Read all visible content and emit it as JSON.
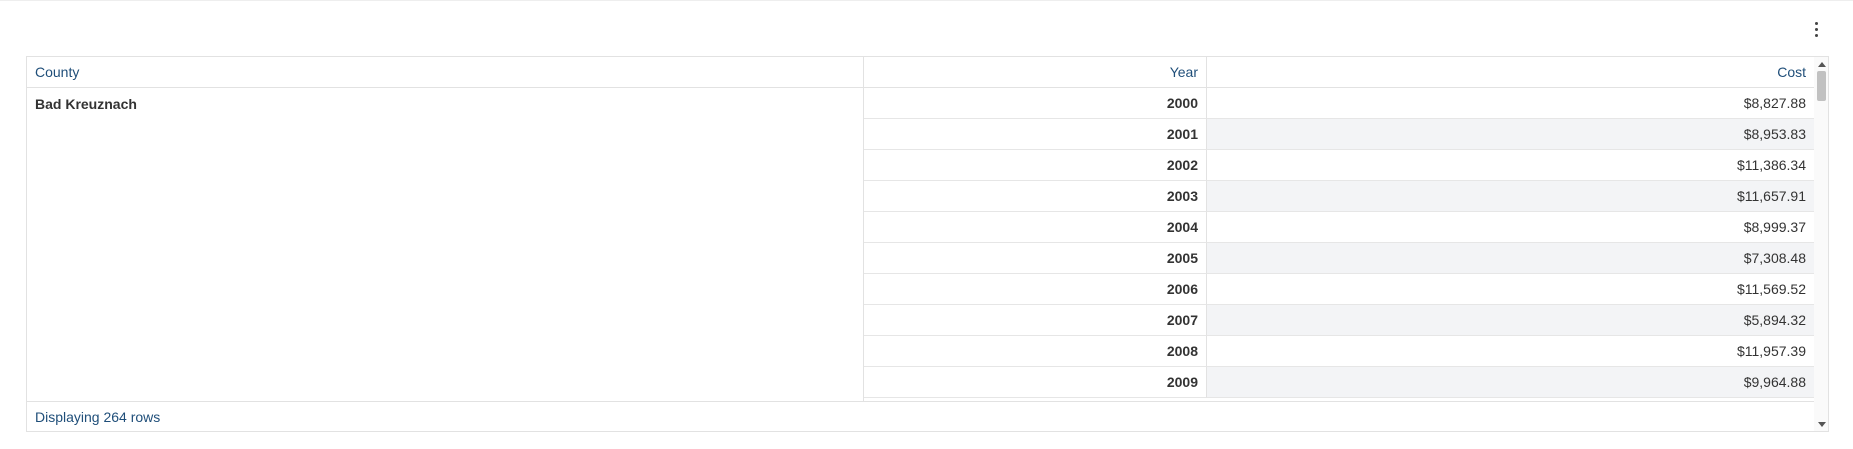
{
  "table": {
    "columns": {
      "county": "County",
      "year": "Year",
      "cost": "Cost"
    },
    "county_group": "Bad Kreuznach",
    "rows": [
      {
        "year": "2000",
        "cost": "$8,827.88"
      },
      {
        "year": "2001",
        "cost": "$8,953.83"
      },
      {
        "year": "2002",
        "cost": "$11,386.34"
      },
      {
        "year": "2003",
        "cost": "$11,657.91"
      },
      {
        "year": "2004",
        "cost": "$8,999.37"
      },
      {
        "year": "2005",
        "cost": "$7,308.48"
      },
      {
        "year": "2006",
        "cost": "$11,569.52"
      },
      {
        "year": "2007",
        "cost": "$5,894.32"
      },
      {
        "year": "2008",
        "cost": "$11,957.39"
      },
      {
        "year": "2009",
        "cost": "$9,964.88"
      }
    ],
    "footer": "Displaying 264 rows"
  },
  "menu": {
    "icon": "kebab-menu-icon"
  },
  "colors": {
    "header_text": "#1f4e79",
    "stripe": "#f3f4f6",
    "border": "#e2e2e2"
  }
}
